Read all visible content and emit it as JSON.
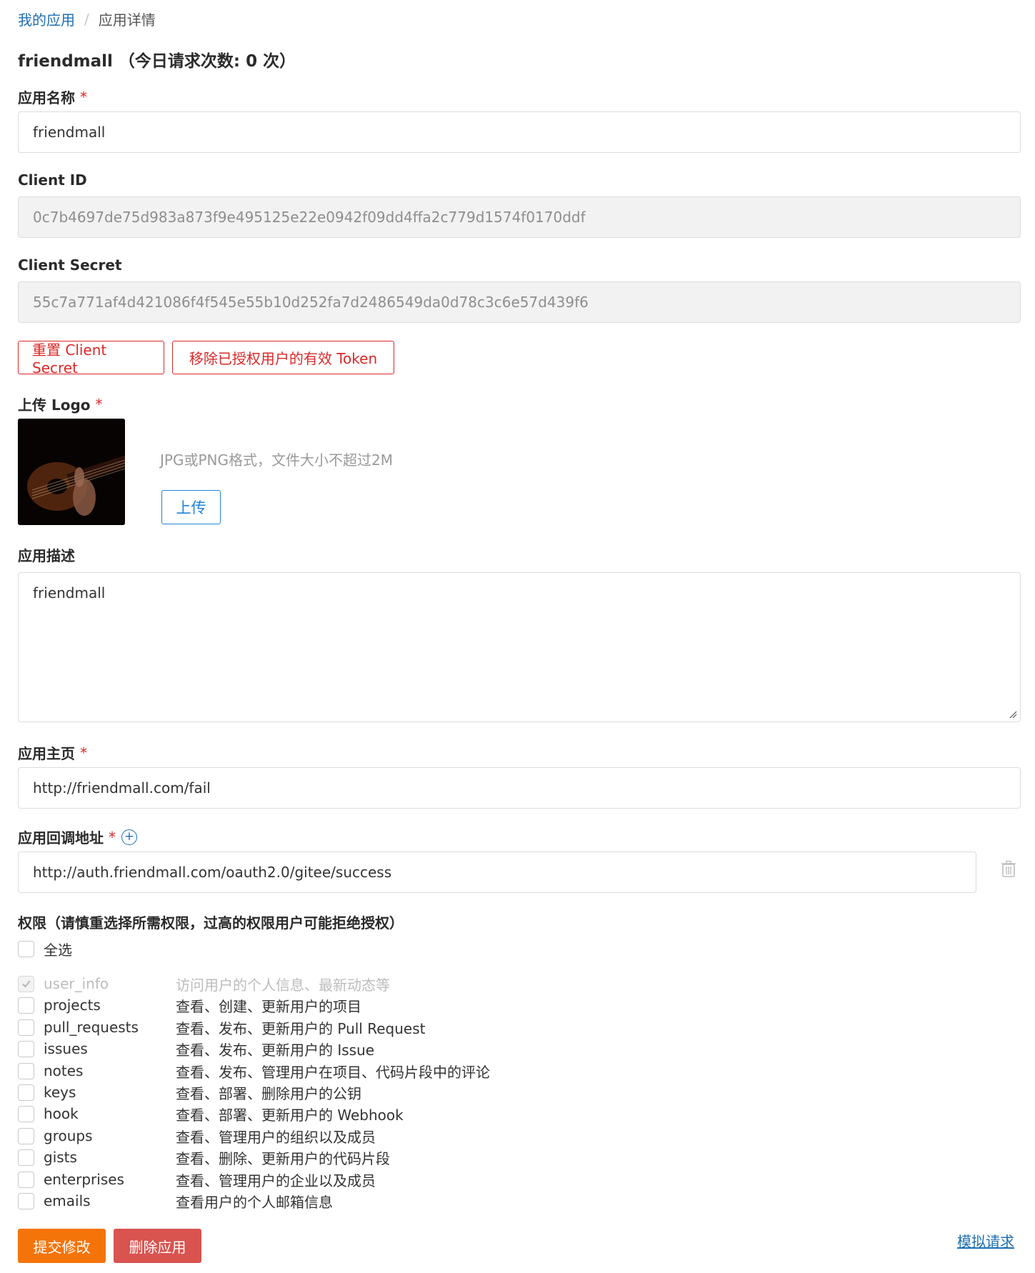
{
  "breadcrumb": {
    "home": "我的应用",
    "separator": "/",
    "current": "应用详情"
  },
  "title": "friendmall （今日请求次数: 0 次）",
  "app_name": {
    "label": "应用名称",
    "required": "*",
    "value": "friendmall"
  },
  "client_id": {
    "label": "Client ID",
    "value": "0c7b4697de75d983a873f9e495125e22e0942f09dd4ffa2c779d1574f0170ddf"
  },
  "client_secret": {
    "label": "Client Secret",
    "value": "55c7a771af4d421086f4f545e55b10d252fa7d2486549da0d78c3c6e57d439f6"
  },
  "actions": {
    "reset_secret": "重置 Client Secret",
    "revoke_tokens": "移除已授权用户的有效 Token"
  },
  "logo": {
    "label": "上传 Logo",
    "required": "*",
    "hint": "JPG或PNG格式，文件大小不超过2M",
    "upload": "上传"
  },
  "description": {
    "label": "应用描述",
    "value": "friendmall"
  },
  "homepage": {
    "label": "应用主页",
    "required": "*",
    "value": "http://friendmall.com/fail"
  },
  "callback": {
    "label": "应用回调地址",
    "required": "*",
    "value": "http://auth.friendmall.com/oauth2.0/gitee/success"
  },
  "permissions": {
    "label": "权限（请慎重选择所需权限，过高的权限用户可能拒绝授权）",
    "select_all": "全选",
    "items": [
      {
        "name": "user_info",
        "desc": "访问用户的个人信息、最新动态等",
        "checked": true,
        "disabled": true
      },
      {
        "name": "projects",
        "desc": "查看、创建、更新用户的项目",
        "checked": false,
        "disabled": false
      },
      {
        "name": "pull_requests",
        "desc": "查看、发布、更新用户的 Pull Request",
        "checked": false,
        "disabled": false
      },
      {
        "name": "issues",
        "desc": "查看、发布、更新用户的 Issue",
        "checked": false,
        "disabled": false
      },
      {
        "name": "notes",
        "desc": "查看、发布、管理用户在项目、代码片段中的评论",
        "checked": false,
        "disabled": false
      },
      {
        "name": "keys",
        "desc": "查看、部署、删除用户的公钥",
        "checked": false,
        "disabled": false
      },
      {
        "name": "hook",
        "desc": "查看、部署、更新用户的 Webhook",
        "checked": false,
        "disabled": false
      },
      {
        "name": "groups",
        "desc": "查看、管理用户的组织以及成员",
        "checked": false,
        "disabled": false
      },
      {
        "name": "gists",
        "desc": "查看、删除、更新用户的代码片段",
        "checked": false,
        "disabled": false
      },
      {
        "name": "enterprises",
        "desc": "查看、管理用户的企业以及成员",
        "checked": false,
        "disabled": false
      },
      {
        "name": "emails",
        "desc": "查看用户的个人邮箱信息",
        "checked": false,
        "disabled": false
      }
    ]
  },
  "footer": {
    "submit": "提交修改",
    "delete": "删除应用",
    "simulate": "模拟请求"
  },
  "colors": {
    "link": "#1f6fb2",
    "danger": "#db2828",
    "primary_orange": "#f5740a",
    "delete_red": "#d9534f",
    "upload_blue": "#1f83d4"
  },
  "icons": {
    "add_callback": "plus-circle-icon",
    "remove_callback": "trash-icon",
    "textarea_resize": "resize-grip-icon",
    "checkbox_checked": "check-icon"
  }
}
